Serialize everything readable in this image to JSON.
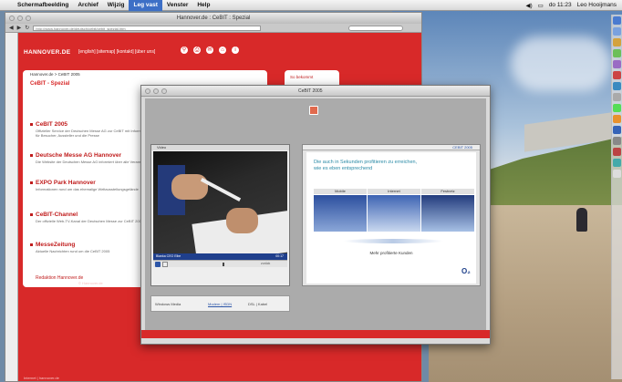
{
  "menubar": {
    "apple_glyph": "",
    "items": [
      "Schermafbeelding",
      "Archief",
      "Wijzig",
      "Leg vast",
      "Venster",
      "Help"
    ],
    "selected_index": 3,
    "clock": "do 11:23",
    "user": "Leo Hooijmans"
  },
  "browser": {
    "title": "Hannover.de : CeBIT : Spezial",
    "address": "http://www.hannover.de/deutsch/cebit/cebit_spezial.htm",
    "brand": "HANNOVER.DE",
    "top_nav": "[english] [sitemap] [kontakt] [über uns]",
    "breadcrumb": "Hannover.de > CeBIT 2005",
    "page_title": "CeBIT - Spezial",
    "articles": [
      {
        "heading": "CeBIT 2005",
        "text": "Offizieller Service der Deutschen Messe AG zur CeBIT mit Informationen für Besucher, Aussteller und die Presse"
      },
      {
        "heading": "Deutsche Messe AG Hannover",
        "text": "Die Website der Deutschen Messe AG informiert über alle Veranstaltungen"
      },
      {
        "heading": "EXPO Park Hannover",
        "text": "Informationen rund um das ehemalige Weltausstellungsgelände"
      },
      {
        "heading": "CeBIT-Channel",
        "text": "Der offizielle Web-TV-Kanal der Deutschen Messe zur CeBIT 2005"
      },
      {
        "heading": "MesseZeitung",
        "text": "Aktuelle Nachrichten rund um die CeBIT 2005"
      }
    ],
    "redaktion_link": "Redaktion Hannover.de",
    "side_box": "So bekommt",
    "footer": "© Hannover.de",
    "bottom_note": "Internet | hannover.de"
  },
  "popup": {
    "title": "CeBIT 2005",
    "video_header": "Video",
    "video_title": "Blanka CEO Elbe",
    "video_time": "00:17",
    "video_link": "zurück",
    "promo_header": "CEBIT 2005",
    "promo_text": "Die auch in Sekunden profitieren zu erreichen, wie es eben entsprechend",
    "tabs": [
      "Mobile",
      "Internet",
      "Festnetz"
    ],
    "promo_caption": "Mehr profitierte Kunden",
    "brand_mark": "O₂",
    "bottom_left": "Windows Media",
    "bottom_mid": "Modem | ISDN",
    "bottom_right": "DSL | Kabel"
  }
}
